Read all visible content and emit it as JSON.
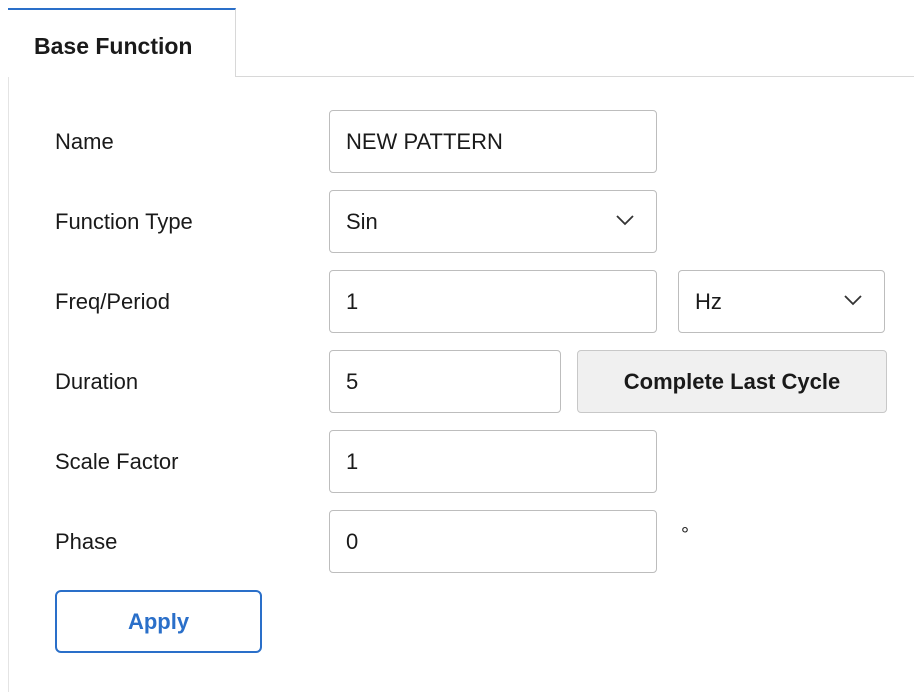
{
  "tabs": [
    {
      "label": "Base Function",
      "active": true
    }
  ],
  "form": {
    "name": {
      "label": "Name",
      "value": "NEW PATTERN"
    },
    "function_type": {
      "label": "Function Type",
      "value": "Sin"
    },
    "freq_period": {
      "label": "Freq/Period",
      "value": "1",
      "unit": "Hz"
    },
    "duration": {
      "label": "Duration",
      "value": "5",
      "button_label": "Complete Last Cycle"
    },
    "scale_factor": {
      "label": "Scale Factor",
      "value": "1"
    },
    "phase": {
      "label": "Phase",
      "value": "0",
      "unit_symbol": "°"
    }
  },
  "actions": {
    "apply_label": "Apply"
  },
  "icons": {
    "dropdown": "chevron-down-icon"
  },
  "colors": {
    "accent": "#2a6fc9",
    "field_border": "#bdbdbd",
    "button_bg": "#f0f0f0"
  }
}
